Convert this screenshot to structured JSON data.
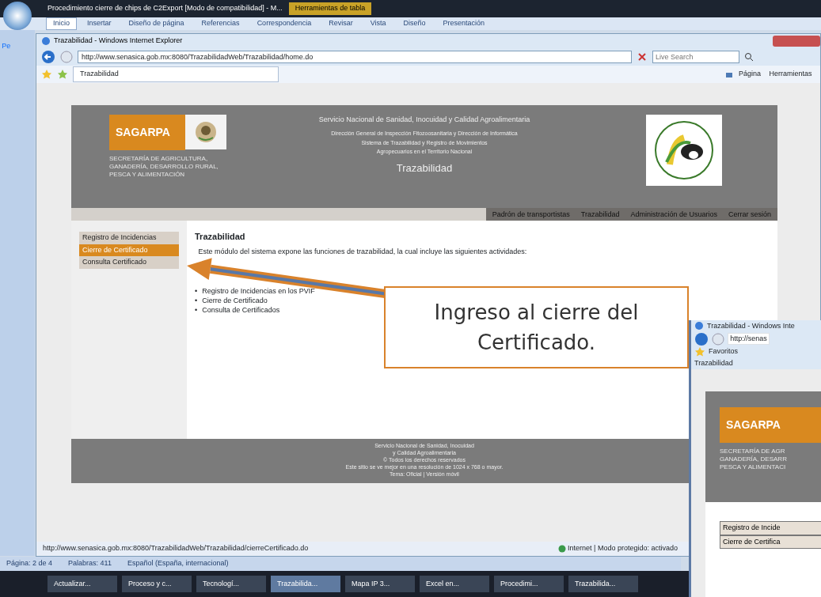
{
  "word": {
    "title": "Procedimiento cierre de chips de C2Export [Modo de compatibilidad] - M...",
    "context_tab": "Herramientas de tabla",
    "ribbon_tabs": [
      {
        "label": "Inicio",
        "selected": true
      },
      {
        "label": "Insertar",
        "selected": false
      },
      {
        "label": "Diseño de página",
        "selected": false
      },
      {
        "label": "Referencias",
        "selected": false
      },
      {
        "label": "Correspondencia",
        "selected": false
      },
      {
        "label": "Revisar",
        "selected": false
      },
      {
        "label": "Vista",
        "selected": false
      },
      {
        "label": "Diseño",
        "selected": false
      },
      {
        "label": "Presentación",
        "selected": false
      }
    ],
    "left_button": "Pe",
    "status": [
      "Página: 2 de 4",
      "Palabras: 411",
      "Español (España, internacional)"
    ]
  },
  "browser": {
    "title": "Trazabilidad - Windows Internet Explorer",
    "url": "http://www.senasica.gob.mx:8080/TrazabilidadWeb/Trazabilidad/home.do",
    "search": {
      "placeholder": "Live Search"
    },
    "tab": "Trazabilidad",
    "tools": [
      "Página",
      "Herramientas"
    ],
    "status_url": "http://www.senasica.gob.mx:8080/TrazabilidadWeb/Trazabilidad/cierreCertificado.do",
    "zone": "Internet | Modo protegido: activado"
  },
  "site": {
    "logo": "SAGARPA",
    "ministry": [
      "SECRETARÍA DE AGRICULTURA,",
      "GANADERÍA, DESARROLLO RURAL,",
      "PESCA Y ALIMENTACIÓN"
    ],
    "header_lines": [
      "Servicio Nacional de Sanidad, Inocuidad y Calidad Agroalimentaria",
      "Dirección General de Inspección Fitozoosanitaria y Dirección de Informática",
      "Sistema de Trazabilidad y Registro de Movimientos",
      "Agropecuarios en el Territorio Nacional"
    ],
    "app_title": "Trazabilidad",
    "nav": [
      {
        "label": "Padrón de transportistas"
      },
      {
        "label": "Trazabilidad"
      },
      {
        "label": "Administración de Usuarios"
      },
      {
        "label": "Cerrar sesión"
      }
    ],
    "menu": [
      {
        "label": "Registro de Incidencias",
        "selected": false
      },
      {
        "label": "Cierre de Certificado",
        "selected": true
      },
      {
        "label": "Consulta Certificado",
        "selected": false
      }
    ],
    "heading": "Trazabilidad",
    "intro": "Este módulo del sistema expone las funciones de trazabilidad, la cual incluye las siguientes actividades:",
    "activities": [
      {
        "bullet": "•",
        "text": "Registro de Incidencias en los PVIF"
      },
      {
        "bullet": "•",
        "text": "Cierre de Certificado"
      },
      {
        "bullet": "•",
        "text": "Consulta de Certificados"
      }
    ],
    "footer": [
      "Servicio Nacional de Sanidad, Inocuidad",
      "y Calidad Agroalimentaria",
      "© Todos los derechos reservados",
      "Este sitio se ve mejor en una resolución de 1024 x 768 o mayor.",
      "Tema: Oficial | Versión móvil"
    ]
  },
  "callout": "Ingreso al cierre del Certificado.",
  "second_browser": {
    "title": "Trazabilidad - Windows Inte",
    "url": "http://senas",
    "favorites": "Favoritos",
    "tab": "Trazabilidad",
    "logo": "SAGARPA",
    "ministry": [
      "SECRETARÍA DE AGR",
      "GANADERÍA, DESARR",
      "PESCA Y ALIMENTACI"
    ],
    "menu": [
      {
        "label": "Registro de Incide",
        "selected": false
      },
      {
        "label": "Cierre de Certifica",
        "selected": false
      }
    ]
  },
  "taskbar": [
    {
      "label": "Actualizar...",
      "selected": false
    },
    {
      "label": "Proceso y c...",
      "selected": false
    },
    {
      "label": "Tecnologí...",
      "selected": false
    },
    {
      "label": "Trazabilida...",
      "selected": true
    },
    {
      "label": "Mapa IP 3...",
      "selected": false
    },
    {
      "label": "Excel en...",
      "selected": false
    },
    {
      "label": "Procedimi...",
      "selected": false
    },
    {
      "label": "Trazabilida...",
      "selected": false
    }
  ]
}
